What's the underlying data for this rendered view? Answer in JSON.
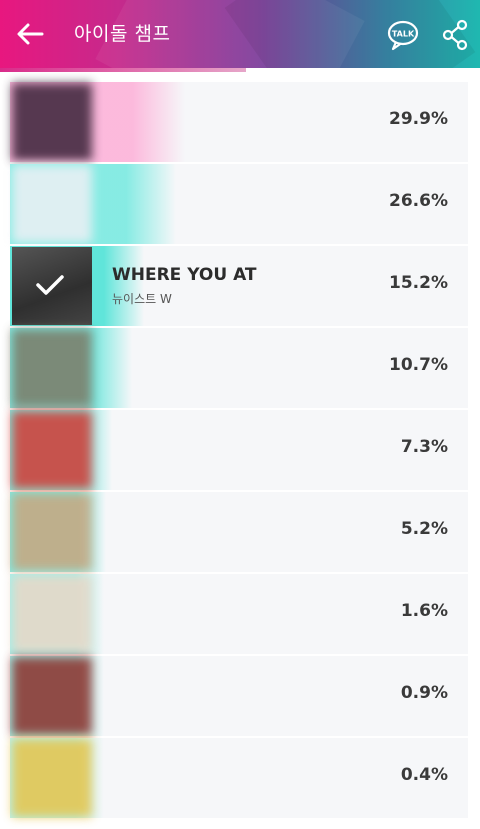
{
  "header": {
    "title": "아이돌 챔프",
    "talk_label": "TALK"
  },
  "colors": {
    "gradient_start": "#e8177f",
    "gradient_end": "#1fb8b0",
    "bar_pink": "#ff9fd0",
    "bar_teal": "#4fe3d6",
    "row_bg": "#f6f7f9"
  },
  "ranking": [
    {
      "title": "",
      "artist": "",
      "percent": "29.9%",
      "share": 0.299,
      "bar_color": "#ff9fd0",
      "thumb_color": "#3a2238",
      "blurred": true,
      "selected": false
    },
    {
      "title": "",
      "artist": "",
      "percent": "26.6%",
      "share": 0.266,
      "bar_color": "#57e6da",
      "thumb_color": "#eef0f5",
      "blurred": true,
      "selected": false
    },
    {
      "title": "WHERE YOU AT",
      "artist": "뉴이스트 W",
      "percent": "15.2%",
      "share": 0.152,
      "bar_color": "#4fe3d6",
      "thumb_color": "#3d3d3d",
      "blurred": false,
      "selected": true
    },
    {
      "title": "",
      "artist": "",
      "percent": "10.7%",
      "share": 0.107,
      "bar_color": "#4fe3d6",
      "thumb_color": "#7a7a66",
      "blurred": true,
      "selected": false
    },
    {
      "title": "",
      "artist": "",
      "percent": "7.3%",
      "share": 0.073,
      "bar_color": "#4fe3d6",
      "thumb_color": "#d33a34",
      "blurred": true,
      "selected": false
    },
    {
      "title": "",
      "artist": "",
      "percent": "5.2%",
      "share": 0.052,
      "bar_color": "#4fe3d6",
      "thumb_color": "#c9a57e",
      "blurred": true,
      "selected": false
    },
    {
      "title": "",
      "artist": "",
      "percent": "1.6%",
      "share": 0.016,
      "bar_color": "#7fece3",
      "thumb_color": "#ead7c6",
      "blurred": true,
      "selected": false
    },
    {
      "title": "",
      "artist": "",
      "percent": "0.9%",
      "share": 0.009,
      "bar_color": "#7fece3",
      "thumb_color": "#8c2f2a",
      "blurred": true,
      "selected": false
    },
    {
      "title": "",
      "artist": "",
      "percent": "0.4%",
      "share": 0.004,
      "bar_color": "#9ff0ea",
      "thumb_color": "#e6c44a",
      "blurred": true,
      "selected": false
    }
  ]
}
